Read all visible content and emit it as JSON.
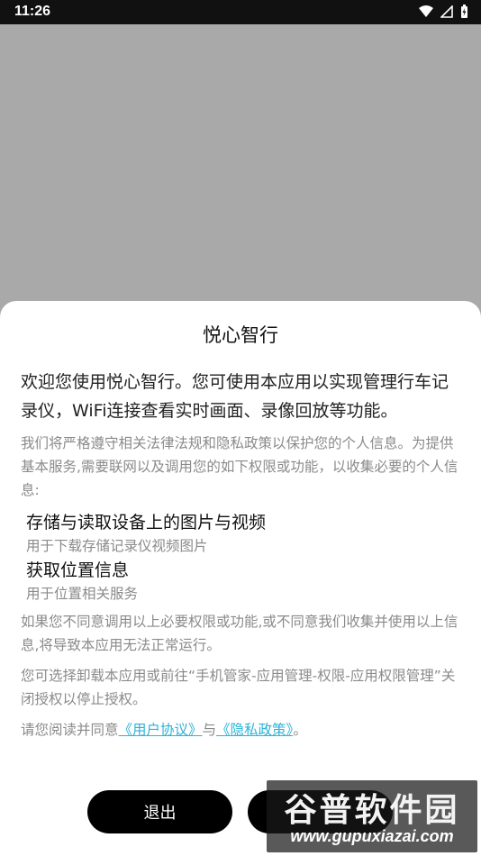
{
  "status_bar": {
    "time": "11:26"
  },
  "dialog": {
    "title": "悦心智行",
    "intro": "欢迎您使用悦心智行。您可使用本应用以实现管理行车记录仪，WiFi连接查看实时画面、录像回放等功能。",
    "notice": "我们将严格遵守相关法律法规和隐私政策以保护您的个人信息。为提供基本服务,需要联网以及调用您的如下权限或功能，以收集必要的个人信息:",
    "permissions": [
      {
        "title": "存储与读取设备上的图片与视频",
        "desc": "用于下载存储记录仪视频图片"
      },
      {
        "title": "获取位置信息",
        "desc": "用于位置相关服务"
      }
    ],
    "disagree_text": "如果您不同意调用以上必要权限或功能,或不同意我们收集并使用以上信息,将导致本应用无法正常运行。",
    "revoke_text": "您可选择卸载本应用或前往“手机管家-应用管理-权限-应用权限管理”关闭授权以停止授权。",
    "agreement": {
      "prefix": "请您阅读并同意",
      "user_agreement": "《用户协议》",
      "and": "与",
      "privacy_policy": "《隐私政策》",
      "suffix": "。"
    },
    "buttons": {
      "exit": "退出"
    }
  },
  "watermark": {
    "title": "谷普软件园",
    "url": "www.gupuxiazai.com"
  }
}
